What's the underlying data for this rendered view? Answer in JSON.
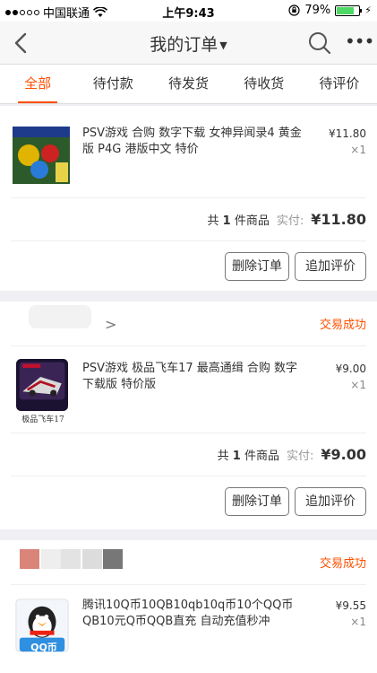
{
  "status_bar": {
    "carrier": "中国联通",
    "time": "上午9:43",
    "battery": "79%",
    "battery_level": 0.79
  },
  "header": {
    "title": "我的订单",
    "back_icon": "back-arrow-icon",
    "search_icon": "search-icon",
    "more_icon": "more-dots-icon"
  },
  "tabs": [
    {
      "label": "全部",
      "active": true
    },
    {
      "label": "待付款"
    },
    {
      "label": "待发货"
    },
    {
      "label": "待收货"
    },
    {
      "label": "待评价"
    }
  ],
  "orders": [
    {
      "title": "PSV游戏 合购 数字下载 女神异闻录4 黄金版 P4G 港版中文 特价",
      "price": "¥11.80",
      "qty": "×1",
      "count_prefix": "共",
      "count_num": "1",
      "count_suffix": "件商品",
      "paid_label": "实付:",
      "paid_value": "¥11.80",
      "delete_label": "删除订单",
      "review_label": "追加评价"
    },
    {
      "status": "交易成功",
      "title": "PSV游戏 极品飞车17 最高通缉 合购 数字下载版 特价版",
      "thumb_caption": "极品飞车17",
      "price": "¥9.00",
      "qty": "×1",
      "count_prefix": "共",
      "count_num": "1",
      "count_suffix": "件商品",
      "paid_label": "实付:",
      "paid_value": "¥9.00",
      "delete_label": "删除订单",
      "review_label": "追加评价"
    },
    {
      "status": "交易成功",
      "title": "腾讯10Q币10QB10qb10q币10个QQ币QB10元Q币QQB直充 自动充值秒冲",
      "thumb_caption": "QQ币",
      "price": "¥9.55",
      "qty": "×1"
    }
  ],
  "colors": {
    "accent": "#ff5000",
    "background": "#efeff4"
  }
}
